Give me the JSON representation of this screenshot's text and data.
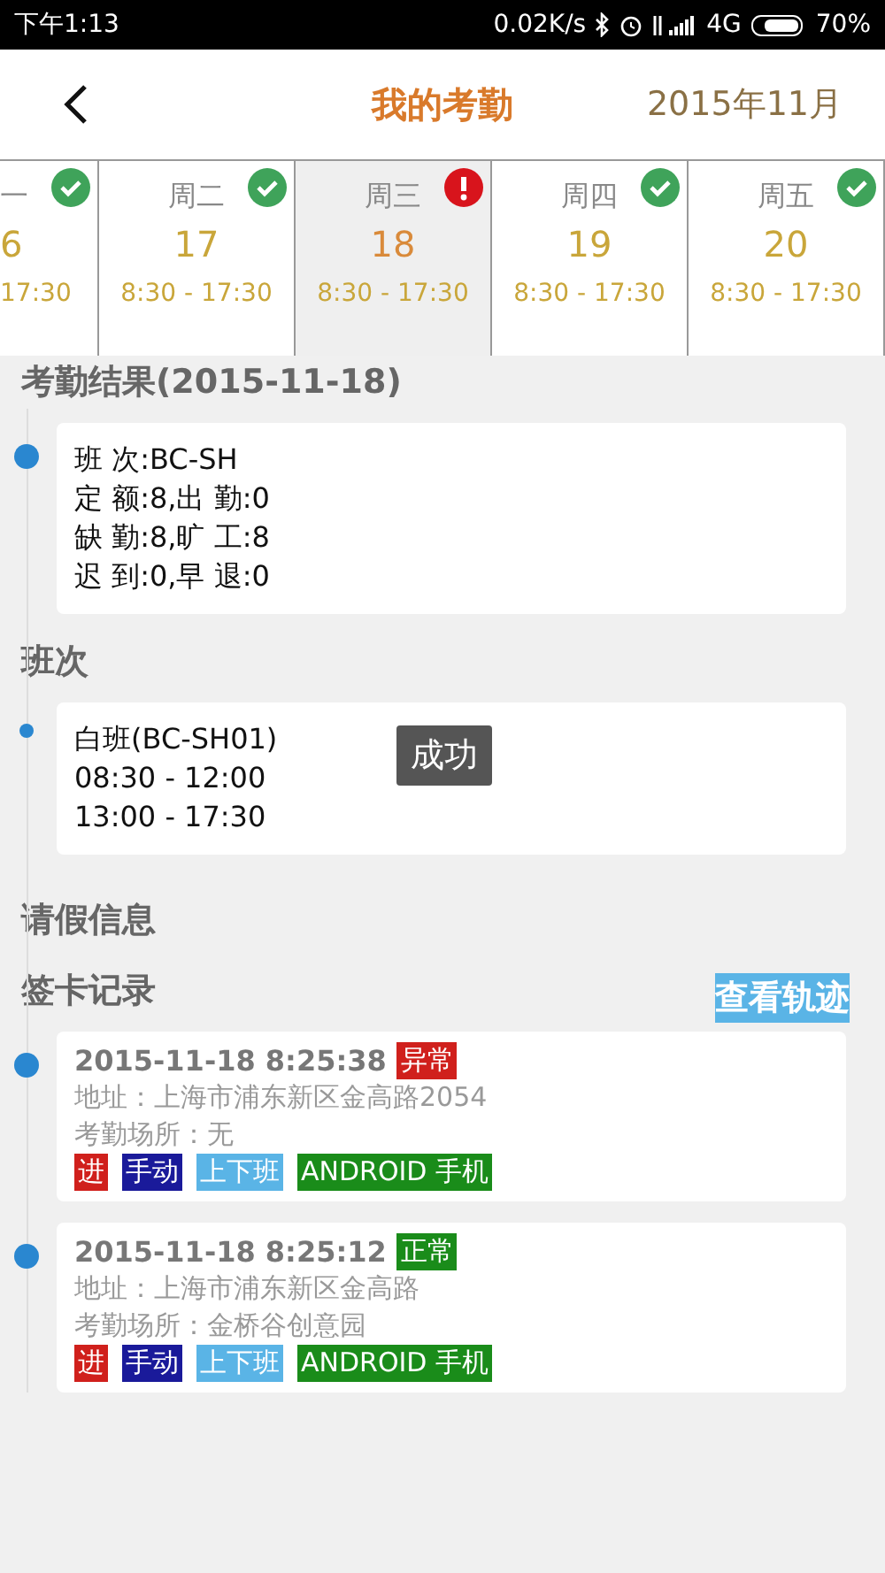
{
  "status_bar": {
    "time": "下午1:13",
    "speed": "0.02K/s",
    "network": "4G",
    "battery": "70%"
  },
  "header": {
    "title": "我的考勤",
    "month": "2015年11月"
  },
  "days": [
    {
      "weekday": "一",
      "date": "6",
      "hours": "17:30",
      "alert": false,
      "selected": false
    },
    {
      "weekday": "周二",
      "date": "17",
      "hours": "8:30 - 17:30",
      "alert": false,
      "selected": false
    },
    {
      "weekday": "周三",
      "date": "18",
      "hours": "8:30 - 17:30",
      "alert": true,
      "selected": true
    },
    {
      "weekday": "周四",
      "date": "19",
      "hours": "8:30 - 17:30",
      "alert": false,
      "selected": false
    },
    {
      "weekday": "周五",
      "date": "20",
      "hours": "8:30 - 17:30",
      "alert": false,
      "selected": false
    }
  ],
  "result": {
    "heading": "考勤结果(2015-11-18)",
    "lines": [
      "班 次:BC-SH",
      "定 额:8,出 勤:0",
      "缺 勤:8,旷 工:8",
      "迟 到:0,早 退:0"
    ]
  },
  "shift": {
    "heading": "班次",
    "lines": [
      "白班(BC-SH01)",
      "08:30 - 12:00",
      "13:00 - 17:30"
    ]
  },
  "toast": "成功",
  "leave": {
    "heading": "请假信息"
  },
  "punch": {
    "heading": "签卡记录",
    "track_button": "查看轨迹",
    "records": [
      {
        "time": "2015-11-18 8:25:38",
        "status": "异常",
        "color": "#d0201c",
        "address": "地址：上海市浦东新区金高路2054",
        "place": "考勤场所：无",
        "tags": [
          {
            "label": "进",
            "color": "#d0201c"
          },
          {
            "label": "手动",
            "color": "#1a1a9a"
          },
          {
            "label": "上下班",
            "color": "#5ab4e6"
          },
          {
            "label": "ANDROID 手机",
            "color": "#1a8c1a"
          }
        ]
      },
      {
        "time": "2015-11-18 8:25:12",
        "status": "正常",
        "color": "#1a8c1a",
        "address": "地址：上海市浦东新区金高路",
        "place": "考勤场所：金桥谷创意园",
        "tags": [
          {
            "label": "进",
            "color": "#d0201c"
          },
          {
            "label": "手动",
            "color": "#1a1a9a"
          },
          {
            "label": "上下班",
            "color": "#5ab4e6"
          },
          {
            "label": "ANDROID 手机",
            "color": "#1a8c1a"
          }
        ]
      }
    ]
  }
}
